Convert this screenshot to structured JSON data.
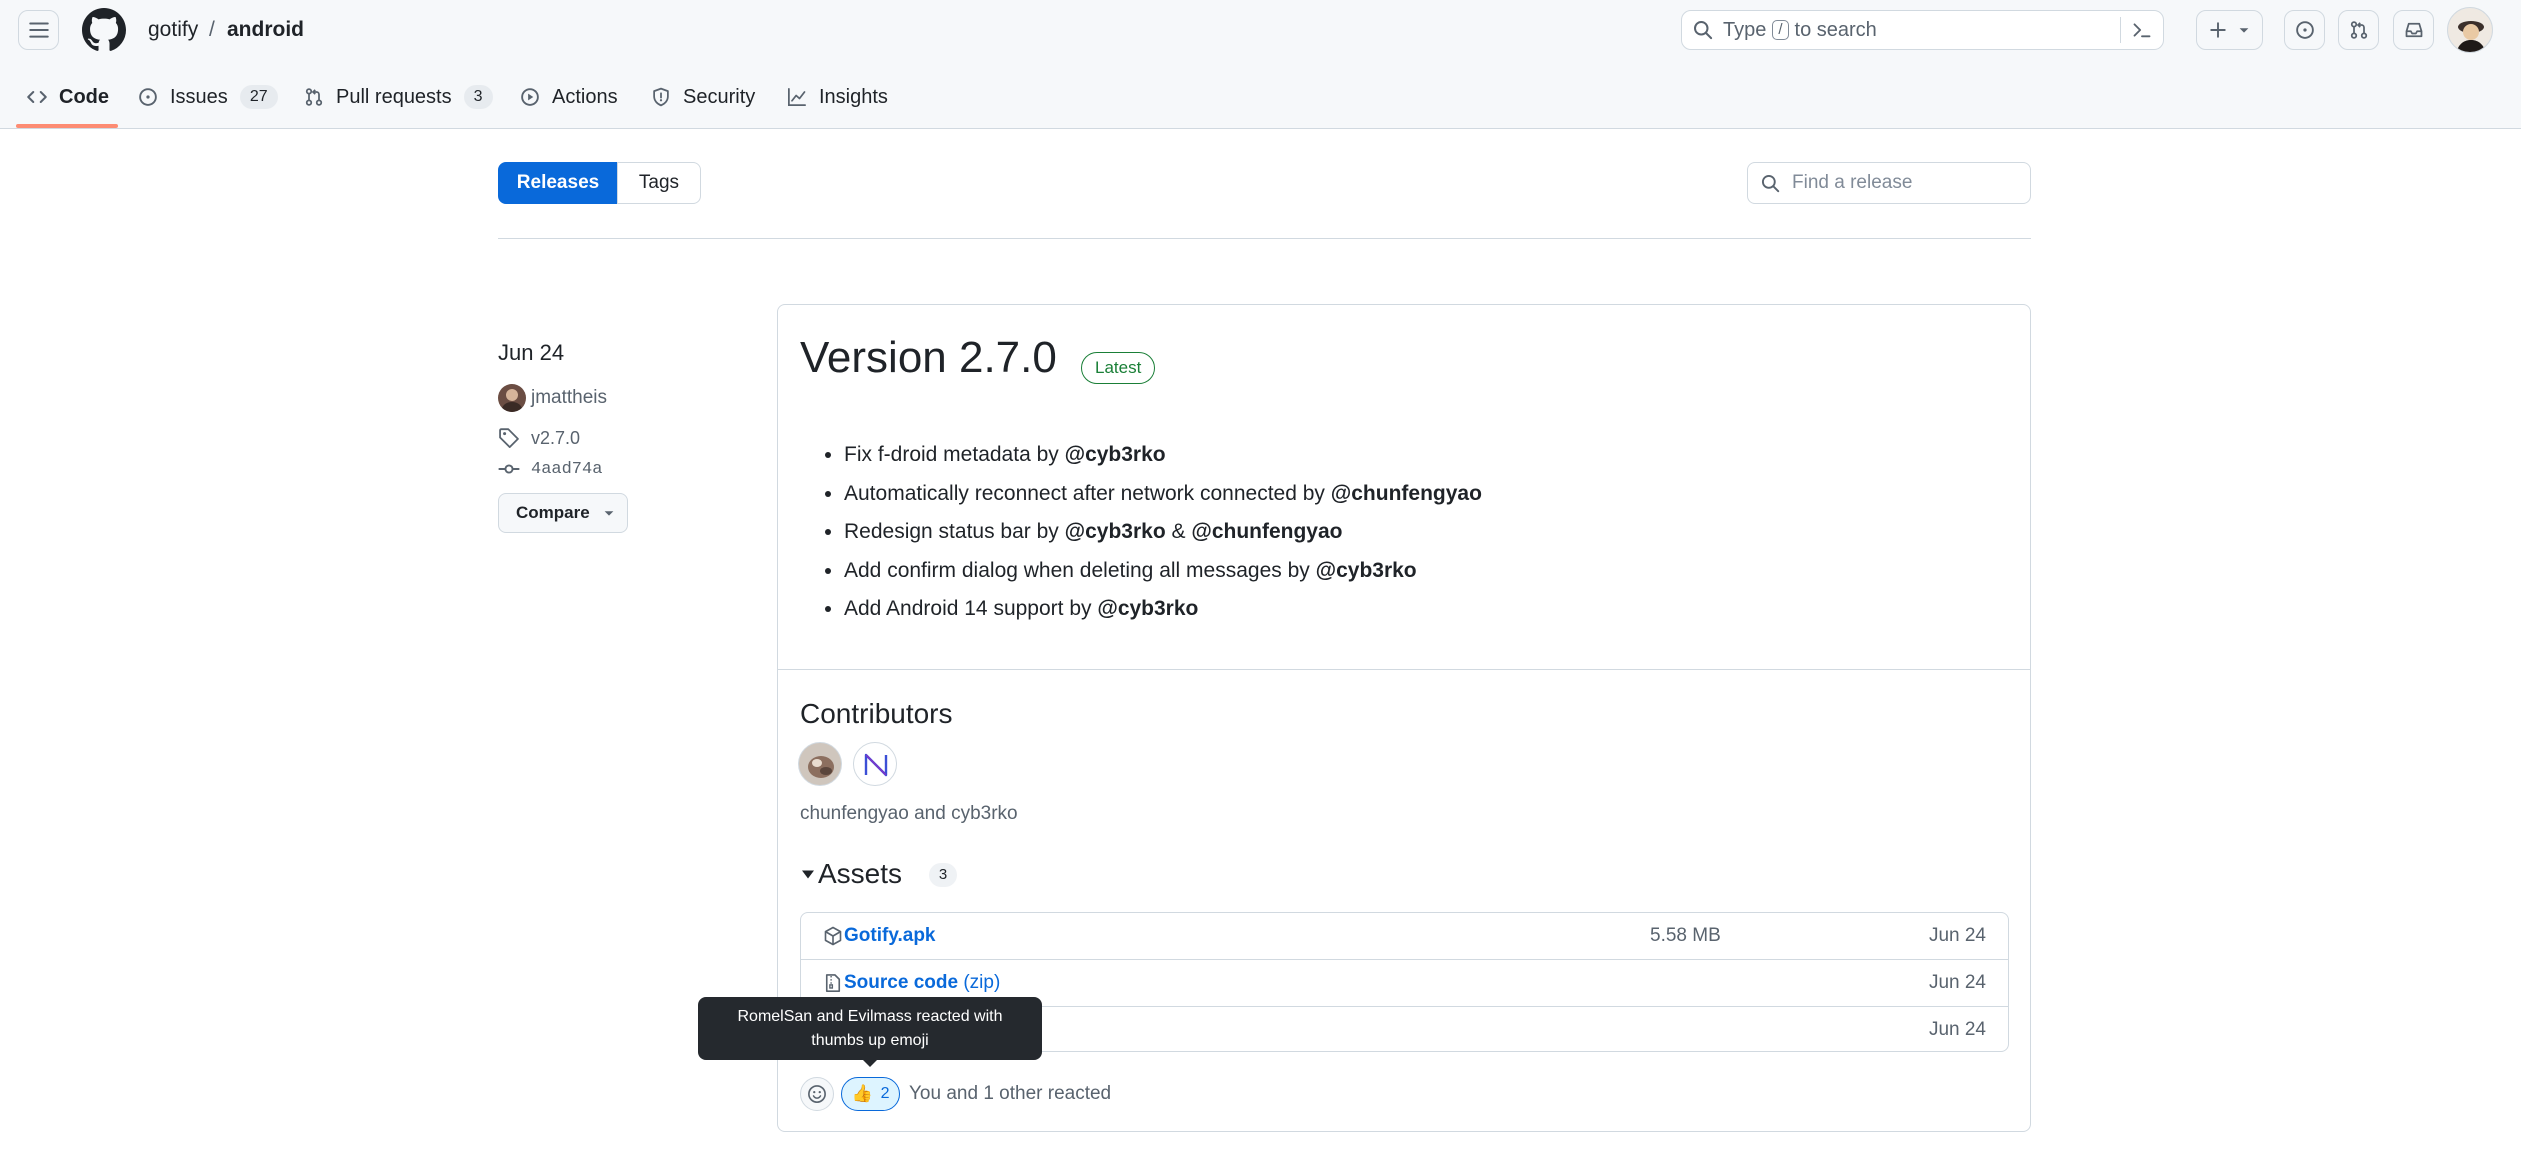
{
  "header": {
    "owner": "gotify",
    "separator": "/",
    "repo": "android",
    "search": {
      "prefix": "Type",
      "key": "/",
      "suffix": "to search"
    }
  },
  "repo_nav": {
    "tabs": [
      {
        "label": "Code",
        "icon": "code-icon"
      },
      {
        "label": "Issues",
        "icon": "issue-opened-icon",
        "count": "27"
      },
      {
        "label": "Pull requests",
        "icon": "git-pull-request-icon",
        "count": "3"
      },
      {
        "label": "Actions",
        "icon": "play-icon"
      },
      {
        "label": "Security",
        "icon": "shield-icon"
      },
      {
        "label": "Insights",
        "icon": "graph-icon"
      }
    ],
    "active_tab": "Code"
  },
  "subnav": {
    "releases_label": "Releases",
    "tags_label": "Tags",
    "find_placeholder": "Find a release"
  },
  "release_meta": {
    "date": "Jun 24",
    "author": "jmattheis",
    "tag": "v2.7.0",
    "commit": "4aad74a",
    "compare_label": "Compare"
  },
  "release": {
    "title": "Version 2.7.0",
    "badge": "Latest",
    "notes": [
      {
        "text": "Fix f-droid metadata by ",
        "mentions": [
          "@cyb3rko"
        ]
      },
      {
        "text": "Automatically reconnect after network connected by ",
        "mentions": [
          "@chunfengyao"
        ]
      },
      {
        "text": "Redesign status bar by ",
        "mentions": [
          "@cyb3rko",
          "@chunfengyao"
        ],
        "joiner": " & "
      },
      {
        "text": "Add confirm dialog when deleting all messages by ",
        "mentions": [
          "@cyb3rko"
        ]
      },
      {
        "text": "Add Android 14 support by ",
        "mentions": [
          "@cyb3rko"
        ]
      }
    ],
    "contributors_heading": "Contributors",
    "contributors_text": "chunfengyao and cyb3rko",
    "assets_heading": "Assets",
    "assets_count": "3",
    "assets": [
      {
        "name": "Gotify.apk",
        "suffix": "",
        "size": "5.58 MB",
        "date": "Jun 24",
        "icon": "package-icon"
      },
      {
        "name": "Source code",
        "suffix": "(zip)",
        "size": "",
        "date": "Jun 24",
        "icon": "file-zip-icon"
      },
      {
        "name": "",
        "suffix": "",
        "size": "",
        "date": "Jun 24",
        "icon": ""
      }
    ],
    "tooltip": "RomelSan and Evilmass reacted with thumbs up emoji",
    "reaction_count": "2",
    "reaction_text": "You and 1 other reacted"
  },
  "colors": {
    "accent_blue": "#0969da",
    "latest_green": "#1a7f37",
    "tab_underline": "#fd8c73",
    "header_bg": "#f6f8fa"
  }
}
